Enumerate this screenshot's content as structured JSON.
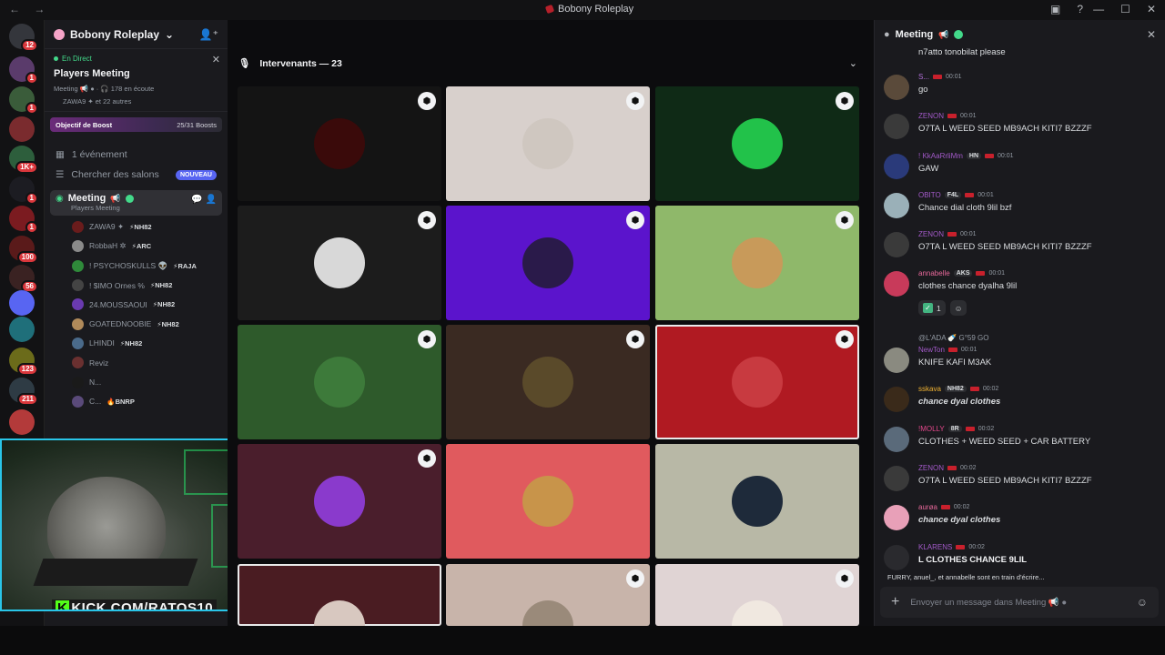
{
  "window": {
    "title": "Bobony Roleplay",
    "nav_label": "← →",
    "buttons": [
      "—",
      "☐",
      "✕"
    ],
    "toolbar_icons": [
      "▣",
      "?"
    ]
  },
  "servers": [
    {
      "badge": "12",
      "color": "#34363c"
    },
    {
      "badge": "1",
      "color": "#5a3b6b"
    },
    {
      "badge": "1",
      "color": "#3a5c3a"
    },
    {
      "badge": "",
      "color": "#7a2b2e"
    },
    {
      "badge": "1K+",
      "color": "#2d5e3c"
    },
    {
      "badge": "1",
      "color": "#1c1c22"
    },
    {
      "badge": "1",
      "color": "#7b1b20"
    },
    {
      "badge": "100",
      "color": "#5a1a1a"
    },
    {
      "badge": "56",
      "color": "#3a2222"
    },
    {
      "badge": "",
      "color": "#5865f2"
    },
    {
      "badge": "",
      "color": "#1f6f7a"
    },
    {
      "badge": "123",
      "color": "#6b6b1a"
    },
    {
      "badge": "211",
      "color": "#2e3b44"
    },
    {
      "badge": "",
      "color": "#b33a3a"
    }
  ],
  "sidebar": {
    "guild_name": "Bobony Roleplay",
    "live_label": "En Direct",
    "live_channel": "Players Meeting",
    "live_meta": "Meeting 📢 ● · 🎧 178 en écoute",
    "live_meta2": "ZAWA9 ✦ et 22 autres",
    "boost_label": "Objectif de Boost",
    "boost_count": "25/31 Boosts",
    "events": "1 événement",
    "search_channels": "Chercher des salons",
    "new_badge": "NOUVEAU",
    "voice_channel": "Meeting",
    "voice_sub": "Players Meeting",
    "members": [
      {
        "name": "ZAWA9 ✦",
        "tag": "⚡NH82",
        "color": "#6a1c1c"
      },
      {
        "name": "RobbaH ✲",
        "tag": "⚡ARC",
        "color": "#8a8a8a"
      },
      {
        "name": "! PSYCHOSKULLS 👽",
        "tag": "⚡RAJA",
        "color": "#2f8a3a"
      },
      {
        "name": "! $IMO Ornes %",
        "tag": "⚡NH82",
        "color": "#444"
      },
      {
        "name": "24.MOUSSAOUI",
        "tag": "⚡NH82",
        "color": "#6a3ab0"
      },
      {
        "name": "GOATEDNOOBIE",
        "tag": "⚡NH82",
        "color": "#b08a5a"
      },
      {
        "name": "LHINDI",
        "tag": "⚡NH82",
        "color": "#4a6a8a"
      },
      {
        "name": "Reviz",
        "tag": "",
        "color": "#6a3030"
      },
      {
        "name": "N...",
        "tag": "",
        "color": "#1a1a1a"
      },
      {
        "name": "C...",
        "tag": "🔥BNRP",
        "color": "#5a4a7a"
      }
    ]
  },
  "webcam": {
    "overlay": "KICK.COM/RATOS10",
    "k": "K"
  },
  "stage": {
    "header": "Intervenants — 23",
    "tiles": [
      {
        "bg": "#141414",
        "pic": "#3a0a0a",
        "shield": true
      },
      {
        "bg": "#d8d0cc",
        "pic": "#cfc7c0",
        "shield": true
      },
      {
        "bg": "#0f2a16",
        "pic": "#22c24a",
        "shield": true
      },
      {
        "bg": "#1c1c1c",
        "pic": "#d8d8d8",
        "shield": true
      },
      {
        "bg": "#5b14cc",
        "pic": "#2a1a4a",
        "shield": true
      },
      {
        "bg": "#8fb86a",
        "pic": "#c89a5a",
        "shield": true
      },
      {
        "bg": "#2e5a2b",
        "pic": "#3d7a3a",
        "shield": true
      },
      {
        "bg": "#3a2a22",
        "pic": "#5a4a2a",
        "shield": true
      },
      {
        "bg": "#b01a22",
        "pic": "#c83a40",
        "shield": true,
        "speaking": true
      },
      {
        "bg": "#4a1e2c",
        "pic": "#8a3acc",
        "shield": true
      },
      {
        "bg": "#e05a5e",
        "pic": "#c8944a",
        "shield": false
      },
      {
        "bg": "#b8b8a6",
        "pic": "#1e2a3a",
        "shield": false
      },
      {
        "bg": "#4a1c22",
        "pic": "#d8c8c0",
        "shield": false,
        "speaking": true
      },
      {
        "bg": "#c8b4aa",
        "pic": "#9a8a7a",
        "shield": true
      },
      {
        "bg": "#e0d4d4",
        "pic": "#f0e8e0",
        "shield": true
      }
    ]
  },
  "chat": {
    "channel": "Meeting",
    "messages": [
      {
        "name": "",
        "time": "",
        "text": "n7atto tonobilat please",
        "color": "#2c2c2c",
        "name_color": "#dbdee1",
        "tag": ""
      },
      {
        "name": "S...",
        "time": "00:01",
        "text": "go",
        "color": "#5a4a3a",
        "name_color": "#b16fd8",
        "tag": ""
      },
      {
        "name": "ZENON",
        "time": "00:01",
        "text": "O7TA L WEED SEED MB9ACH KITI7 BZZZF",
        "color": "#3a3a3a",
        "name_color": "#a259c8",
        "tag": ""
      },
      {
        "name": "! KkAaRrliMm",
        "time": "00:01",
        "text": "GAW",
        "color": "#2a3a7a",
        "name_color": "#a259c8",
        "tag": "HN"
      },
      {
        "name": "OBITO",
        "time": "00:01",
        "text": "Chance dial cloth 9lil bzf",
        "color": "#9ab0b8",
        "name_color": "#a259c8",
        "tag": "F4L"
      },
      {
        "name": "ZENON",
        "time": "00:01",
        "text": "O7TA L WEED SEED MB9ACH KITI7 BZZZF",
        "color": "#3a3a3a",
        "name_color": "#a259c8",
        "tag": ""
      },
      {
        "name": "annabelle",
        "time": "00:01",
        "text": "clothes  chance dyalha 9lil",
        "color": "#c83a5a",
        "name_color": "#e7689a",
        "tag": "AKS"
      },
      {
        "name": "NewTon",
        "time": "00:01",
        "text": "KNIFE KAFI M3AK",
        "color": "#8a8a80",
        "name_color": "#a259c8",
        "tag": ""
      },
      {
        "name": "sskava",
        "time": "00:02",
        "text": "chance dyal clothes",
        "color": "#3a2a1a",
        "name_color": "#f0b232",
        "tag": "NH82"
      },
      {
        "name": "!MOLLY",
        "time": "00:02",
        "text": "CLOTHES + WEED SEED + CAR BATTERY",
        "color": "#5a6a7a",
        "name_color": "#e0478a",
        "tag": "8R"
      },
      {
        "name": "ZENON",
        "time": "00:02",
        "text": "O7TA L WEED SEED MB9ACH KITI7 BZZZF",
        "color": "#3a3a3a",
        "name_color": "#a259c8",
        "tag": ""
      },
      {
        "name": "aurøa",
        "time": "00:02",
        "text": "chance dyal clothes",
        "color": "#e8a0b8",
        "name_color": "#e7689a",
        "tag": ""
      },
      {
        "name": "KLARENS",
        "time": "00:02",
        "text": "L CLOTHES CHANCE 9LIL",
        "color": "#2a2a2e",
        "name_color": "#a259c8",
        "tag": ""
      }
    ],
    "reply_snippet": "@L'ADA 🍼 G°59 GO",
    "reaction_count": "1",
    "typing": "FURRY, anuel_, et annabelle sont en train d'écrire...",
    "composer_placeholder": "Envoyer un message dans Meeting 📢 ●"
  }
}
